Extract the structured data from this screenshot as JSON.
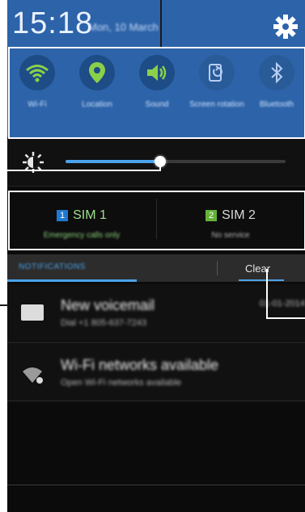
{
  "status": {
    "time": "15:18",
    "date": "Mon, 10 March",
    "settings_icon": "gear-icon"
  },
  "quick_toggles": [
    {
      "label": "Wi-Fi",
      "icon": "wifi-icon",
      "active": true
    },
    {
      "label": "Location",
      "icon": "location-pin-icon",
      "active": true
    },
    {
      "label": "Sound",
      "icon": "speaker-icon",
      "active": true
    },
    {
      "label": "Screen rotation",
      "icon": "rotation-icon",
      "active": false
    },
    {
      "label": "Bluetooth",
      "icon": "bluetooth-icon",
      "active": false
    }
  ],
  "brightness": {
    "icon": "brightness-icon",
    "level": 0.43
  },
  "sims": [
    {
      "badge": "1",
      "name": "SIM 1",
      "status": "Emergency calls only",
      "badge_color": "#1f79d1"
    },
    {
      "badge": "2",
      "name": "SIM 2",
      "status": "No service",
      "badge_color": "#62b237"
    }
  ],
  "notifications_header": {
    "tab": "NOTIFICATIONS",
    "clear": "Clear"
  },
  "notifications": [
    {
      "icon": "voicemail-icon",
      "title": "New voicemail",
      "subtitle": "Dial +1 805-637-7243",
      "time": "01-01-2014"
    },
    {
      "icon": "wifi-available-icon",
      "title": "Wi-Fi networks available",
      "subtitle": "Open Wi-Fi networks available",
      "time": ""
    }
  ],
  "colors": {
    "panel_blue": "#2d63a8",
    "accent": "#4aa3ea"
  }
}
